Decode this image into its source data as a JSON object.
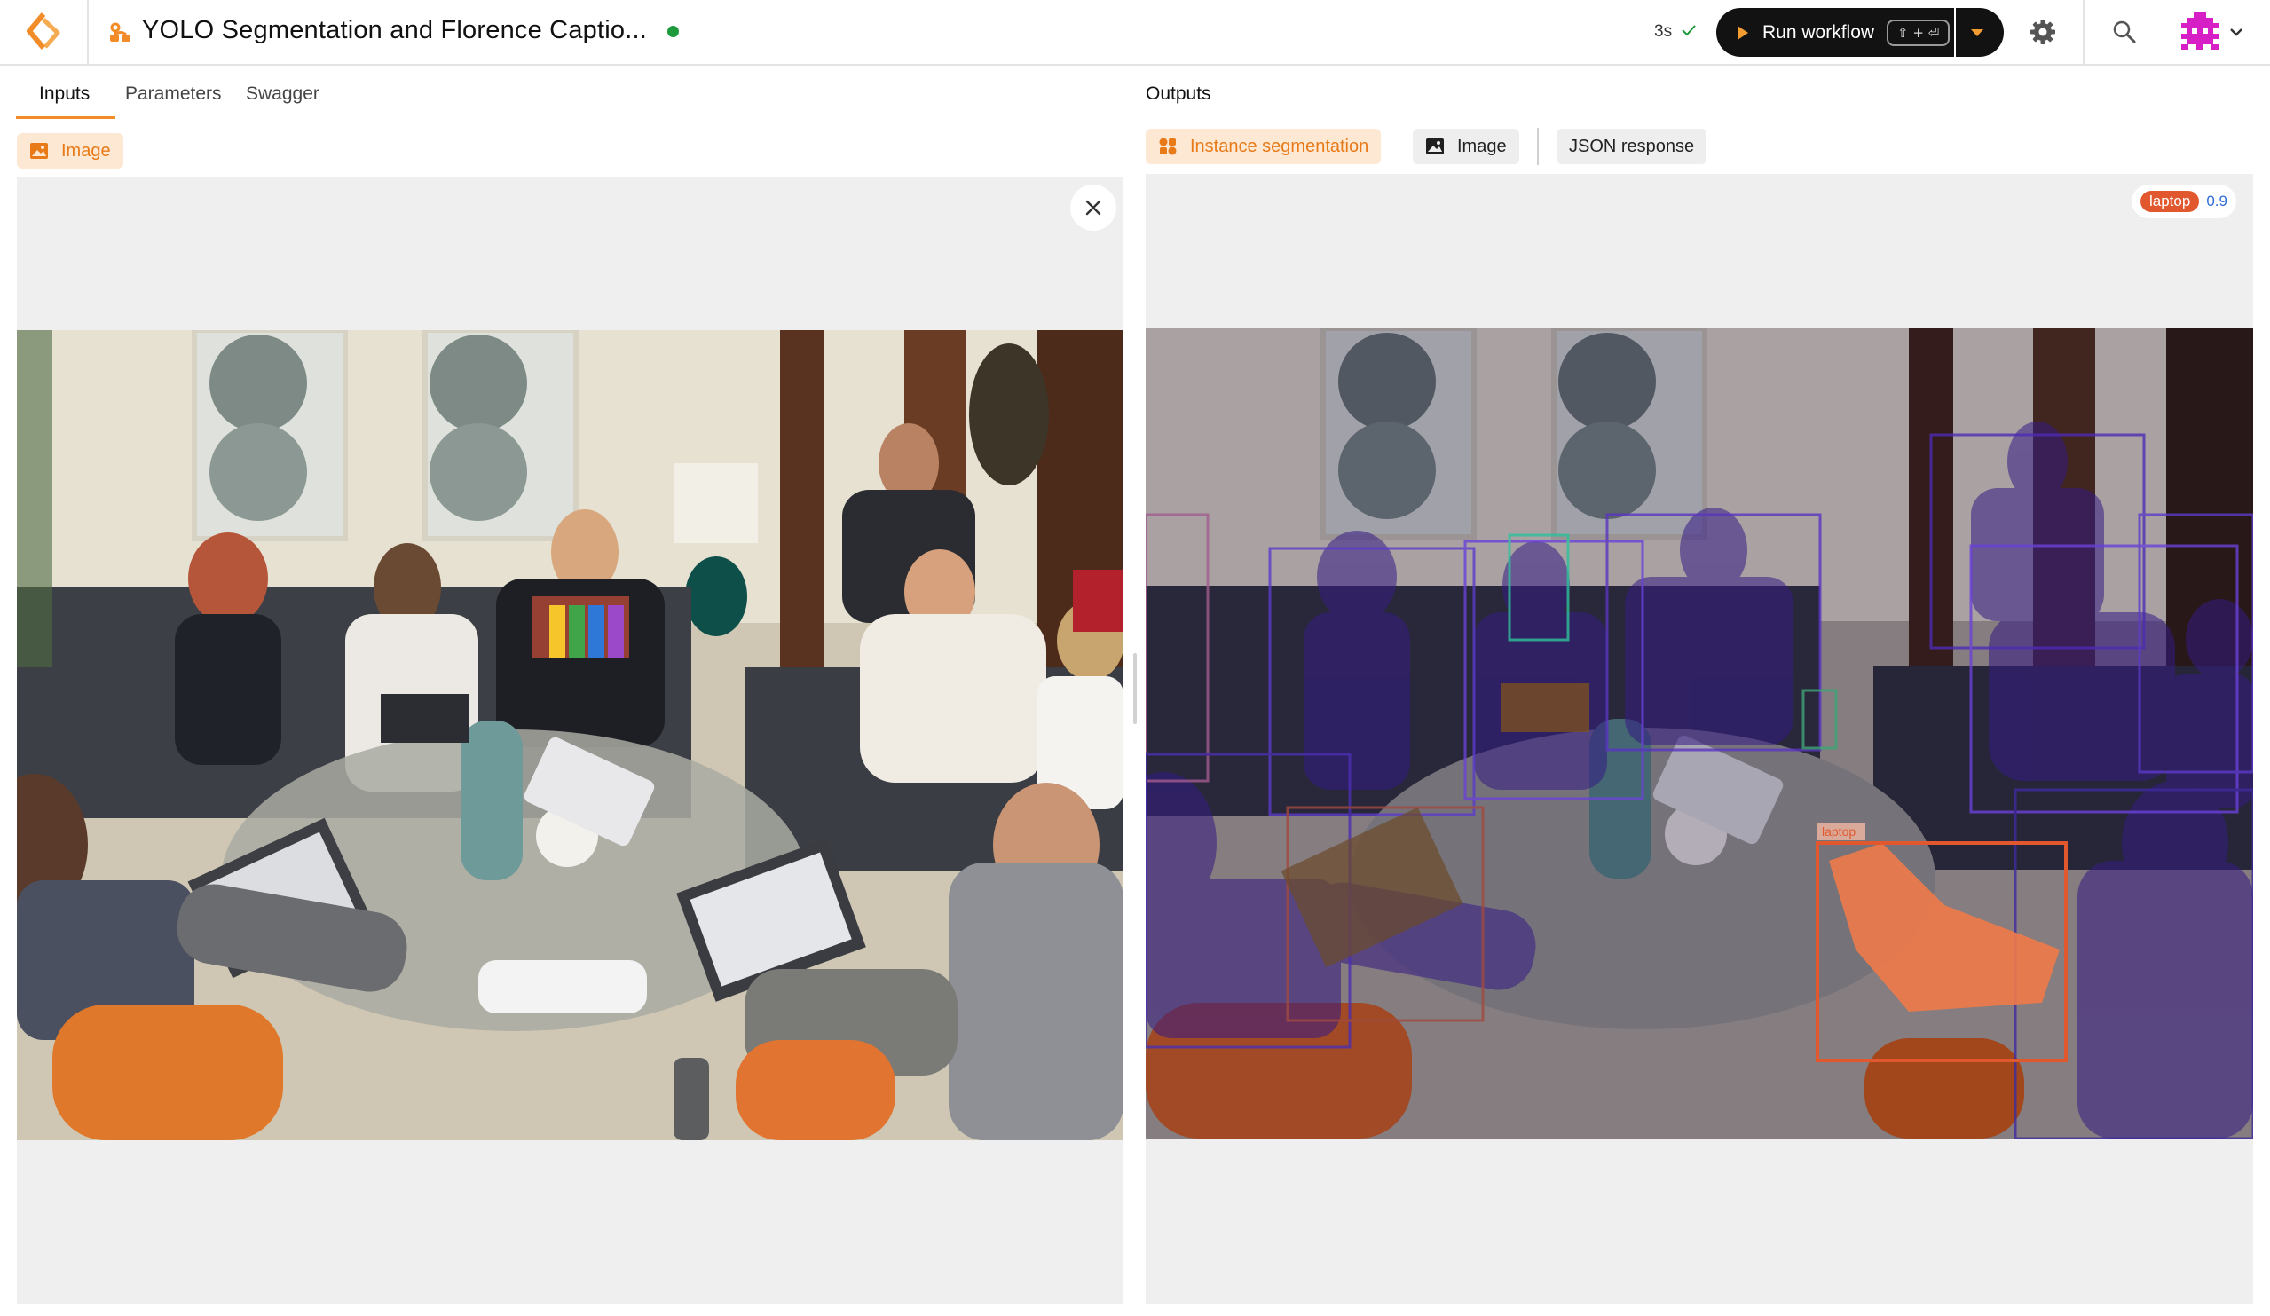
{
  "header": {
    "workflow_title": "YOLO Segmentation and Florence Captio...",
    "run_time": "3s",
    "run_label": "Run workflow",
    "shortcut": "⇧ + ⏎",
    "icons": [
      "roboflow-logo-icon",
      "workflow-icon",
      "check-icon",
      "play-icon",
      "chevron-down-icon",
      "gear-icon",
      "search-icon",
      "avatar-icon"
    ]
  },
  "inputs": {
    "tabs": [
      {
        "label": "Inputs",
        "active": true
      },
      {
        "label": "Parameters",
        "active": false
      },
      {
        "label": "Swagger",
        "active": false
      }
    ],
    "chip": "Image"
  },
  "outputs": {
    "title": "Outputs",
    "chips": [
      {
        "label": "Instance segmentation",
        "active": true
      },
      {
        "label": "Image",
        "active": false
      },
      {
        "label": "JSON response",
        "active": false
      }
    ],
    "detection": {
      "label": "laptop",
      "score": "0.9"
    },
    "overlay_label": "laptop"
  },
  "colors": {
    "accent": "#f28c28",
    "status": "#1d9a3c",
    "detection": "#e2582e",
    "score": "#2e6bd9"
  }
}
